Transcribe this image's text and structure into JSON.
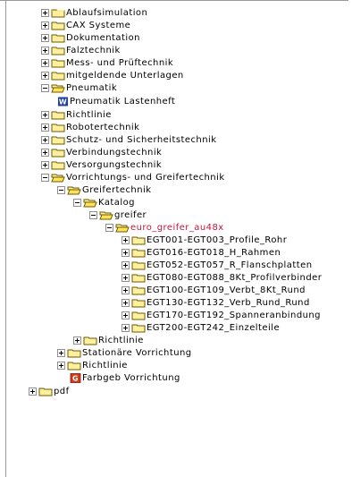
{
  "tree": {
    "items": [
      {
        "label": "Ablaufsimulation",
        "toggle": "plus",
        "icon": "folder-icon"
      },
      {
        "label": "CAX Systeme",
        "toggle": "plus",
        "icon": "folder-icon"
      },
      {
        "label": "Dokumentation",
        "toggle": "plus",
        "icon": "folder-icon"
      },
      {
        "label": "Falztechnik",
        "toggle": "plus",
        "icon": "folder-icon"
      },
      {
        "label": "Mess- und Prüftechnik",
        "toggle": "plus",
        "icon": "folder-icon"
      },
      {
        "label": "mitgeldende Unterlagen",
        "toggle": "plus",
        "icon": "folder-icon"
      },
      {
        "label": "Pneumatik",
        "toggle": "minus",
        "icon": "folder-open-icon"
      },
      {
        "label": "Pneumatik Lastenheft",
        "toggle": "none",
        "icon": "word-document-icon",
        "icon_letter": "W"
      },
      {
        "label": "Richtlinie",
        "toggle": "plus",
        "icon": "folder-icon"
      },
      {
        "label": "Robotertechnik",
        "toggle": "plus",
        "icon": "folder-icon"
      },
      {
        "label": "Schutz- und Sicherheitstechnik",
        "toggle": "plus",
        "icon": "folder-icon"
      },
      {
        "label": "Verbindungstechnik",
        "toggle": "plus",
        "icon": "folder-icon"
      },
      {
        "label": "Versorgungstechnik",
        "toggle": "plus",
        "icon": "folder-icon"
      },
      {
        "label": "Vorrichtungs- und Greifertechnik",
        "toggle": "minus",
        "icon": "folder-open-icon"
      },
      {
        "label": "Greifertechnik",
        "toggle": "minus",
        "icon": "folder-open-icon"
      },
      {
        "label": "Katalog",
        "toggle": "minus",
        "icon": "folder-open-icon"
      },
      {
        "label": "greifer",
        "toggle": "minus",
        "icon": "folder-open-icon"
      },
      {
        "label": "euro_greifer_au48x",
        "toggle": "minus",
        "icon": "folder-open-icon",
        "active": true
      },
      {
        "label": "EGT001-EGT003_Profile_Rohr",
        "toggle": "plus",
        "icon": "folder-icon"
      },
      {
        "label": "EGT016-EGT018_H_Rahmen",
        "toggle": "plus",
        "icon": "folder-icon"
      },
      {
        "label": "EGT052-EGT057_R_Flanschplatten",
        "toggle": "plus",
        "icon": "folder-icon"
      },
      {
        "label": "EGT080-EGT088_8Kt_Profilverbinder",
        "toggle": "plus",
        "icon": "folder-icon"
      },
      {
        "label": "EGT100-EGT109_Verbt_8Kt_Rund",
        "toggle": "plus",
        "icon": "folder-icon"
      },
      {
        "label": "EGT130-EGT132_Verb_Rund_Rund",
        "toggle": "plus",
        "icon": "folder-icon"
      },
      {
        "label": "EGT170-EGT192_Spanneranbindung",
        "toggle": "plus",
        "icon": "folder-icon"
      },
      {
        "label": "EGT200-EGT242_Einzelteile",
        "toggle": "plus",
        "icon": "folder-icon"
      },
      {
        "label": "Richtlinie",
        "toggle": "plus",
        "icon": "folder-icon"
      },
      {
        "label": "Stationäre Vorrichtung",
        "toggle": "plus",
        "icon": "folder-icon"
      },
      {
        "label": "Richtlinie",
        "toggle": "plus",
        "icon": "folder-icon"
      },
      {
        "label": "Farbgeb Vorrichtung",
        "toggle": "none",
        "icon": "pdf-document-icon",
        "icon_letter": "G"
      },
      {
        "label": "pdf",
        "toggle": "plus",
        "icon": "folder-icon"
      }
    ]
  },
  "colors": {
    "folder_fill": "#fff0a0",
    "folder_tab": "#ffe15a",
    "folder_outline": "#6b5a00",
    "word_icon": "#1f3fa0",
    "pdf_icon": "#d43a1a",
    "active_text": "#c0143c",
    "border": "#9a9a9a"
  }
}
